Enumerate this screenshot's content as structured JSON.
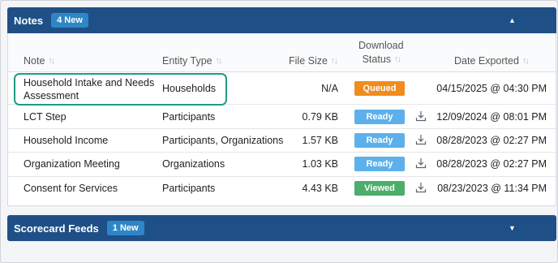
{
  "notes_panel": {
    "title": "Notes",
    "badge": "4 New",
    "caret": "▲"
  },
  "table": {
    "headers": {
      "note": "Note",
      "entity_type": "Entity Type",
      "file_size": "File Size",
      "status_line1": "Download",
      "status_line2": "Status",
      "date_exported": "Date Exported",
      "sort_glyph": "↑↓"
    },
    "rows": [
      {
        "note_line1": "Household Intake and Needs",
        "note_line2": "Assessment",
        "entity_type": "Households",
        "file_size": "N/A",
        "status": "Queued",
        "status_color": "#f08c1e",
        "download_icon": "",
        "date_exported": "04/15/2025 @ 04:30 PM"
      },
      {
        "note": "LCT Step",
        "entity_type": "Participants",
        "file_size": "0.79 KB",
        "status": "Ready",
        "status_color": "#5cb0ec",
        "download_icon": "download-icon",
        "date_exported": "12/09/2024 @ 08:01 PM"
      },
      {
        "note": "Household Income",
        "entity_type": "Participants, Organizations",
        "file_size": "1.57 KB",
        "status": "Ready",
        "status_color": "#5cb0ec",
        "download_icon": "download-icon",
        "date_exported": "08/28/2023 @ 02:27 PM"
      },
      {
        "note": "Organization Meeting",
        "entity_type": "Organizations",
        "file_size": "1.03 KB",
        "status": "Ready",
        "status_color": "#5cb0ec",
        "download_icon": "download-icon",
        "date_exported": "08/28/2023 @ 02:27 PM"
      },
      {
        "note": "Consent for Services",
        "entity_type": "Participants",
        "file_size": "4.43 KB",
        "status": "Viewed",
        "status_color": "#4bae6a",
        "download_icon": "download-icon",
        "date_exported": "08/23/2023 @ 11:34 PM"
      }
    ]
  },
  "scorecard_panel": {
    "title": "Scorecard Feeds",
    "badge": "1 New",
    "caret": "▼"
  },
  "colors": {
    "header_bg": "#1f4f87",
    "badge_bg": "#2e86c8",
    "highlight_border": "#1e9c86"
  }
}
